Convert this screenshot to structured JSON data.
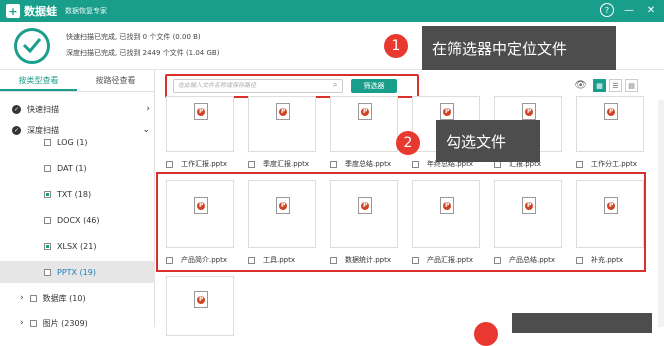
{
  "titlebar": {
    "logo": "+",
    "app_name": "数据蛙",
    "subtitle": "数据恢复专家",
    "help": "?",
    "minimize": "—",
    "close": "✕"
  },
  "status": {
    "line1": "快速扫描已完成, 已找到 0 个文件 (0.00  B)",
    "line2": "深度扫描已完成, 已找到 2449 个文件 (1.04 GB)"
  },
  "sidebar": {
    "tabs": [
      "按类型查看",
      "按路径查看"
    ],
    "sections": [
      {
        "label": "快速扫描",
        "chev": "›"
      },
      {
        "label": "深度扫描",
        "chev": "⌄"
      }
    ],
    "items": [
      {
        "label": "LOG (1)",
        "checked": false
      },
      {
        "label": "DAT (1)",
        "checked": false
      },
      {
        "label": "TXT (18)",
        "checked": true
      },
      {
        "label": "DOCX (46)",
        "checked": false
      },
      {
        "label": "XLSX (21)",
        "checked": true
      },
      {
        "label": "PPTX (19)",
        "checked": false,
        "selected": true
      },
      {
        "label": "数据库 (10)",
        "checked": false,
        "expander": "›"
      },
      {
        "label": "图片 (2309)",
        "checked": false,
        "expander": "›"
      }
    ]
  },
  "search": {
    "placeholder": "在此输入文件名称或保存路径",
    "filter_label": "筛选器"
  },
  "view": {
    "eye": "👁",
    "grid": "▦",
    "list": "☰",
    "detail": "▤"
  },
  "files_row1": [
    "工作汇报.pptx",
    "季度汇报.pptx",
    "季度总结.pptx",
    "年终总结.pptx",
    "汇报.pptx",
    "工作分工.pptx"
  ],
  "files_row2": [
    "产品简介.pptx",
    "工具.pptx",
    "数据统计.pptx",
    "产品汇报.pptx",
    "产品总结.pptx",
    "补充.pptx"
  ],
  "ppt_glyph": "P",
  "callouts": [
    {
      "num": "1",
      "text": "在筛选器中定位文件"
    },
    {
      "num": "2",
      "text": "勾选文件"
    }
  ]
}
